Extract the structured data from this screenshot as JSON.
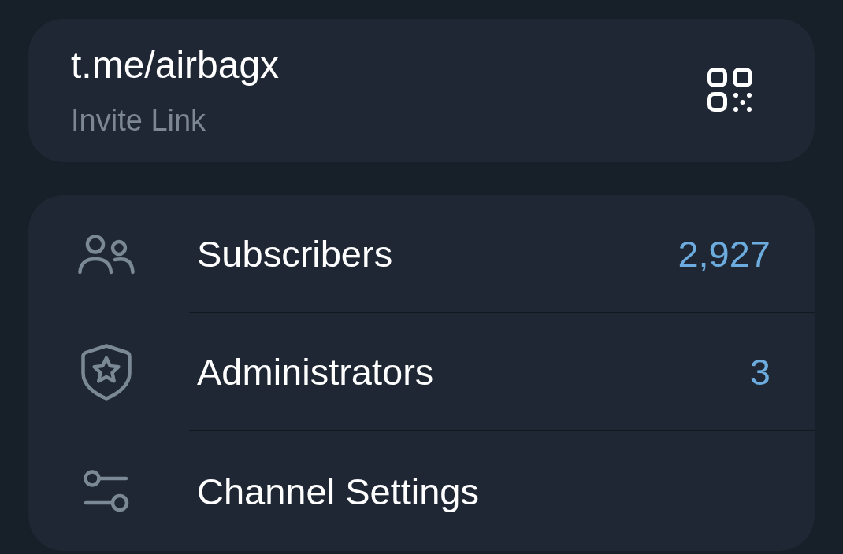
{
  "invite_link": {
    "link": "t.me/airbagx",
    "label": "Invite Link"
  },
  "rows": [
    {
      "label": "Subscribers",
      "value": "2,927"
    },
    {
      "label": "Administrators",
      "value": "3"
    },
    {
      "label": "Channel Settings"
    }
  ]
}
